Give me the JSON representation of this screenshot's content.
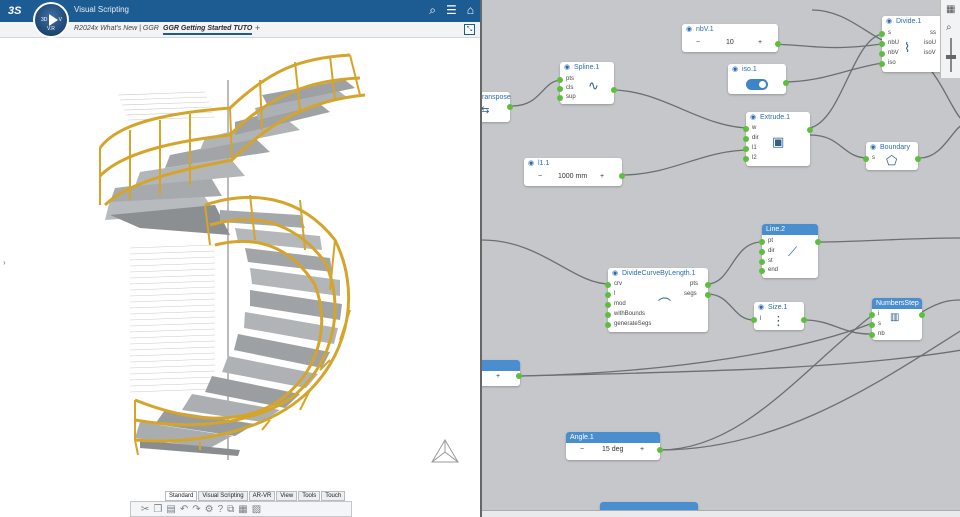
{
  "header": {
    "brand": "3S",
    "app_title": "Visual Scripting",
    "compass_version": "V.R",
    "compass_3d": "3D",
    "compass_v": "V",
    "icons": [
      "search-icon",
      "menu-icon",
      "tag-icon"
    ]
  },
  "tabs": [
    {
      "label": "R2024x What's New | GGR",
      "active": false
    },
    {
      "label": "GGR Getting Started TUTO",
      "active": true
    }
  ],
  "tab_add": "+",
  "bottom_tabs": [
    "Standard",
    "Visual Scripting",
    "AR-VR",
    "View",
    "Tools",
    "Touch"
  ],
  "bottom_toolbar_icons": [
    "cut-icon",
    "copy-icon",
    "paste-icon",
    "undo-icon",
    "redo-icon",
    "settings-icon",
    "help-icon",
    "group-icon",
    "layout-icon",
    "chart-icon"
  ],
  "colors": {
    "header": "#1d5b93",
    "railing": "#d4a52a",
    "stairs": "#9ea2a6",
    "port": "#5cbf3c",
    "node_blue": "#4a8ed0"
  },
  "nodes": {
    "nbv": {
      "title": "nbV.1",
      "minus": "−",
      "value": "10",
      "plus": "+"
    },
    "divide": {
      "title": "Divide.1",
      "ports_in": [
        "s",
        "nbU",
        "nbV",
        "iso"
      ],
      "ports_out": [
        "ss",
        "isoU",
        "isoV"
      ]
    },
    "iso": {
      "title": "iso.1"
    },
    "spline": {
      "title": "Spline.1",
      "ports_in": [
        "pts",
        "cls",
        "sup"
      ]
    },
    "transpose": {
      "title": "ranspose"
    },
    "extrude": {
      "title": "Extrude.1",
      "ports_in": [
        "w",
        "dir",
        "l1",
        "l2"
      ]
    },
    "boundary": {
      "title": "Boundary",
      "ports_in": [
        "s"
      ]
    },
    "l1": {
      "title": "l1.1",
      "minus": "−",
      "value": "1000 mm",
      "plus": "+"
    },
    "line": {
      "title": "Line.2",
      "ports_in": [
        "pt",
        "dir",
        "st",
        "end"
      ]
    },
    "divide_curve": {
      "title": "DivideCurveByLength.1",
      "ports_in": [
        "crv",
        "l",
        "mod",
        "withBounds",
        "generateSegs"
      ],
      "ports_out": [
        "pts",
        "segs"
      ]
    },
    "size": {
      "title": "Size.1",
      "ports_in": [
        "l"
      ]
    },
    "numbers_step": {
      "title": "NumbersStep",
      "ports_in": [
        "i",
        "s",
        "nb"
      ]
    },
    "angle": {
      "title": "Angle.1",
      "minus": "−",
      "value": "15 deg",
      "plus": "+"
    },
    "partial_plus": "+"
  },
  "right_tools": [
    "map-icon",
    "zoom-icon"
  ]
}
